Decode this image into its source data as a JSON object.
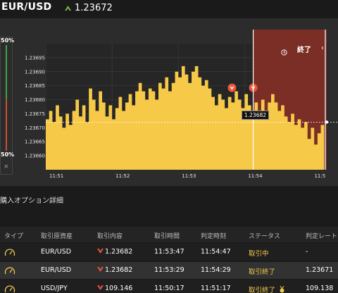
{
  "header": {
    "pair": "EUR/USD",
    "price": "1.23672",
    "direction_icon": "up-triangle-icon",
    "accent_green": "#6cbf3a"
  },
  "chart": {
    "pct_top": "50%",
    "pct_bottom": "50%",
    "close_symbol": "×",
    "end_label": "終了",
    "current_tag": "1.23682",
    "expiry_zone_color": "#7a2e25"
  },
  "chart_data": {
    "type": "area",
    "title": "",
    "xlabel": "",
    "ylabel": "",
    "y_ticks": [
      "1.23695",
      "1.23690",
      "1.23685",
      "1.23680",
      "1.23675",
      "1.23670",
      "1.23665",
      "1.23660"
    ],
    "x_ticks": [
      "11:51",
      "11:52",
      "11:53",
      "11:54",
      "11:5"
    ],
    "ylim": [
      1.23655,
      1.237
    ],
    "x_minutes_range": [
      0,
      4.25
    ],
    "series": [
      {
        "color": "#f7c948",
        "x": [
          0,
          0.05,
          0.1,
          0.15,
          0.2,
          0.25,
          0.3,
          0.35,
          0.4,
          0.45,
          0.5,
          0.55,
          0.6,
          0.65,
          0.7,
          0.75,
          0.8,
          0.85,
          0.9,
          0.95,
          1.0,
          1.05,
          1.1,
          1.15,
          1.2,
          1.25,
          1.3,
          1.35,
          1.4,
          1.45,
          1.5,
          1.55,
          1.6,
          1.65,
          1.7,
          1.75,
          1.8,
          1.85,
          1.9,
          1.95,
          2.0,
          2.05,
          2.1,
          2.15,
          2.2,
          2.25,
          2.3,
          2.35,
          2.4,
          2.45,
          2.5,
          2.55,
          2.6,
          2.65,
          2.7,
          2.75,
          2.8,
          2.85,
          2.9,
          2.95,
          3.0,
          3.05,
          3.1,
          3.15,
          3.2,
          3.25,
          3.3,
          3.35,
          3.4,
          3.45,
          3.5,
          3.55,
          3.6,
          3.65,
          3.7,
          3.75,
          3.8,
          3.85,
          3.9,
          3.95,
          4.0,
          4.05,
          4.1,
          4.15,
          4.2
        ],
        "y": [
          1.23673,
          1.23676,
          1.23672,
          1.23678,
          1.23674,
          1.2367,
          1.23675,
          1.23671,
          1.23676,
          1.2368,
          1.23674,
          1.23678,
          1.23672,
          1.23684,
          1.2368,
          1.23676,
          1.23683,
          1.23679,
          1.23674,
          1.23678,
          1.23673,
          1.23677,
          1.23681,
          1.23676,
          1.23679,
          1.23682,
          1.23678,
          1.23683,
          1.23686,
          1.23683,
          1.2368,
          1.23684,
          1.23683,
          1.2368,
          1.23686,
          1.23684,
          1.23688,
          1.23683,
          1.23686,
          1.2369,
          1.23688,
          1.23692,
          1.23689,
          1.23686,
          1.2369,
          1.23692,
          1.23688,
          1.23685,
          1.23687,
          1.23684,
          1.23681,
          1.23678,
          1.23682,
          1.2368,
          1.23677,
          1.23681,
          1.23679,
          1.23683,
          1.2368,
          1.23677,
          1.23682,
          1.23678,
          1.23675,
          1.23679,
          1.23676,
          1.2368,
          1.23676,
          1.23679,
          1.23682,
          1.23679,
          1.23676,
          1.23678,
          1.23674,
          1.23672,
          1.23675,
          1.23671,
          1.23673,
          1.2367,
          1.23672,
          1.23666,
          1.2367,
          1.23664,
          1.23668,
          1.23671,
          1.23672
        ]
      }
    ],
    "markers": [
      {
        "x": 2.81,
        "y": 1.23682,
        "icon": "down-arrow-icon"
      },
      {
        "x": 3.13,
        "y": 1.23682,
        "icon": "down-arrow-icon"
      }
    ],
    "current_value": 1.23672,
    "expiry_zone": [
      3.13,
      4.25
    ],
    "grid": true
  },
  "details": {
    "title": "購入オプション詳細",
    "columns": [
      "タイプ",
      "取引原資産",
      "取引内容",
      "取引時間",
      "判定時刻",
      "ステータス",
      "判定レート"
    ],
    "rows": [
      {
        "asset": "EUR/USD",
        "content": "1.23682",
        "trade_time": "11:53:47",
        "judge_time": "11:54:47",
        "status": "取引中",
        "rate": "-",
        "type_icon": "gauge-icon",
        "direction_icon": "down-arrow-icon",
        "status_icon": ""
      },
      {
        "asset": "EUR/USD",
        "content": "1.23682",
        "trade_time": "11:53:29",
        "judge_time": "11:54:29",
        "status": "取引終了",
        "rate": "1.23671",
        "type_icon": "gauge-icon",
        "direction_icon": "down-arrow-icon",
        "status_icon": ""
      },
      {
        "asset": "USD/JPY",
        "content": "109.146",
        "trade_time": "11:50:17",
        "judge_time": "11:51:17",
        "status": "取引終了",
        "rate": "109.138",
        "type_icon": "gauge-icon",
        "direction_icon": "down-arrow-icon",
        "status_icon": "win-medal-icon"
      }
    ]
  }
}
